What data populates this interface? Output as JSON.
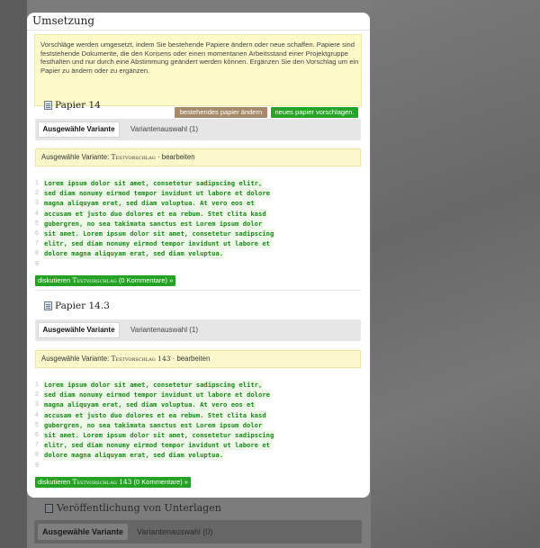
{
  "dialog": {
    "title": "Umsetzung",
    "notice": "Vorschläge werden umgesetzt, indem Sie bestehende Papiere ändern oder neue schaffen. Papiere sind feststehende Dokumente, die den Konsens oder einen momentanen Arbeitsstand einer Projektgruppe festhalten und nur durch eine Abstimmung geändert werden können. Ergänzen Sie den Vorschlag um ein Papier zu ändern oder zu ergänzen.",
    "change_button": "bestehendes papier ändern",
    "new_button": "neues papier vorschlagen."
  },
  "papers": [
    {
      "title": "Papier 14",
      "tab_selected": "Ausgewähle Variante",
      "tab_other": "Variantenauswahl (1)",
      "variant_prefix": "Ausgewähle Variante:",
      "variant_name": "Testvorschlag",
      "variant_sep": "·",
      "variant_edit": "bearbeiten",
      "lines": [
        "Lorem ipsum dolor sit amet, consetetur sadipscing elitr,",
        "sed diam nonumy eirmod tempor invidunt ut labore et dolore",
        "magna aliquyam erat, sed diam voluptua. At vero eos et",
        "accusam et justo duo dolores et ea rebum. Stet clita kasd",
        "gubergren, no sea takimata sanctus est Lorem ipsum dolor",
        "sit amet. Lorem ipsum dolor sit amet, consetetur sadipscing",
        "elitr, sed diam nonumy eirmod tempor invidunt ut labore et",
        "dolore magna aliquyam erat, sed diam voluptua.",
        ""
      ],
      "discuss_prefix": "diskutieren",
      "discuss_name": "Testvorschlag",
      "discuss_suffix": "(0 Kommentare) »"
    },
    {
      "title": "Papier 14.3",
      "tab_selected": "Ausgewähle Variante",
      "tab_other": "Variantenauswahl (1)",
      "variant_prefix": "Ausgewähle Variante:",
      "variant_name": "Testvorschlag 143",
      "variant_sep": "·",
      "variant_edit": "bearbeiten",
      "lines": [
        "Lorem ipsum dolor sit amet, consetetur sadipscing elitr,",
        "sed diam nonumy eirmod tempor invidunt ut labore et dolore",
        "magna aliquyam erat, sed diam voluptua. At vero eos et",
        "accusam et justo duo dolores et ea rebum. Stet clita kasd",
        "gubergren, no sea takimata sanctus est Lorem ipsum dolor",
        "sit amet. Lorem ipsum dolor sit amet, consetetur sadipscing",
        "elitr, sed diam nonumy eirmod tempor invidunt ut labore et",
        "dolore magna aliquyam erat, sed diam voluptua.",
        ""
      ],
      "discuss_prefix": "diskutieren",
      "discuss_name": "Testvorschlag 143",
      "discuss_suffix": "(0 Kommentare) »"
    }
  ],
  "background": {
    "section_title": "Veröffentlichung von Unterlagen",
    "tab_selected": "Ausgewähle Variante",
    "tab_other": "Variantenauswahl (0)"
  },
  "icons": {
    "paper": "document-icon"
  }
}
